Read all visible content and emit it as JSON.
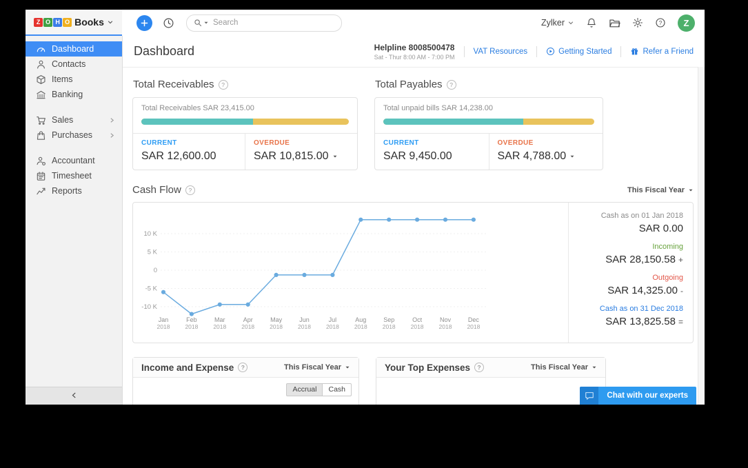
{
  "topbar": {
    "logo_tiles": [
      {
        "letter": "Z",
        "color": "#e5342f"
      },
      {
        "letter": "O",
        "color": "#41a044"
      },
      {
        "letter": "H",
        "color": "#3a7ce8"
      },
      {
        "letter": "O",
        "color": "#f0b01f"
      }
    ],
    "brand": "Books",
    "search_placeholder": "Search",
    "org_name": "Zylker",
    "avatar_letter": "Z"
  },
  "sidebar": {
    "items": [
      {
        "label": "Dashboard",
        "icon": "gauge",
        "active": true
      },
      {
        "label": "Contacts",
        "icon": "contacts"
      },
      {
        "label": "Items",
        "icon": "items"
      },
      {
        "label": "Banking",
        "icon": "banking"
      },
      {
        "label": "Sales",
        "icon": "sales",
        "expandable": true,
        "gap_before": true
      },
      {
        "label": "Purchases",
        "icon": "purchases",
        "expandable": true
      },
      {
        "label": "Accountant",
        "icon": "accountant",
        "gap_before": true
      },
      {
        "label": "Timesheet",
        "icon": "timesheet"
      },
      {
        "label": "Reports",
        "icon": "reports"
      }
    ]
  },
  "header": {
    "title": "Dashboard",
    "helpline": "Helpline 8008500478",
    "helpline_hours": "Sat - Thur 8:00 AM - 7:00 PM",
    "vat_link": "VAT Resources",
    "getting_started": "Getting Started",
    "refer": "Refer a Friend"
  },
  "receivables": {
    "title": "Total Receivables",
    "summary": "Total Receivables SAR 23,415.00",
    "progress_pct": 53.8,
    "current_label": "CURRENT",
    "current_value": "SAR 12,600.00",
    "overdue_label": "OVERDUE",
    "overdue_value": "SAR 10,815.00"
  },
  "payables": {
    "title": "Total Payables",
    "summary": "Total unpaid bills SAR 14,238.00",
    "progress_pct": 66.4,
    "current_label": "CURRENT",
    "current_value": "SAR 9,450.00",
    "overdue_label": "OVERDUE",
    "overdue_value": "SAR 4,788.00"
  },
  "cashflow": {
    "title": "Cash Flow",
    "period": "This Fiscal Year",
    "stats": [
      {
        "label": "Cash as on 01 Jan 2018",
        "value": "SAR 0.00",
        "op": "",
        "tone": "muted"
      },
      {
        "label": "Incoming",
        "value": "SAR 28,150.58",
        "op": "+",
        "tone": "green"
      },
      {
        "label": "Outgoing",
        "value": "SAR 14,325.00",
        "op": "-",
        "tone": "red"
      },
      {
        "label": "Cash as on 31 Dec 2018",
        "value": "SAR 13,825.58",
        "op": "=",
        "tone": "blue"
      }
    ]
  },
  "chart_data": {
    "type": "line",
    "title": "Cash Flow",
    "x": [
      "Jan 2018",
      "Feb 2018",
      "Mar 2018",
      "Apr 2018",
      "May 2018",
      "Jun 2018",
      "Jul 2018",
      "Aug 2018",
      "Sep 2018",
      "Oct 2018",
      "Nov 2018",
      "Dec 2018"
    ],
    "values": [
      -6000,
      -12000,
      -9400,
      -9400,
      -1300,
      -1300,
      -1300,
      13825.58,
      13825.58,
      13825.58,
      13825.58,
      13825.58
    ],
    "yticks": [
      {
        "label": "10 K",
        "value": 10000
      },
      {
        "label": "5 K",
        "value": 5000
      },
      {
        "label": "0",
        "value": 0
      },
      {
        "label": "-5 K",
        "value": -5000
      },
      {
        "label": "-10 K",
        "value": -10000
      }
    ],
    "ylim": [
      -13800,
      15600
    ],
    "xlabel": "",
    "ylabel": "",
    "grid": true,
    "legend": "none",
    "line_color": "#6aabdf"
  },
  "income_expense": {
    "title": "Income and Expense",
    "period": "This Fiscal Year",
    "toggles": [
      "Accrual",
      "Cash"
    ],
    "active_toggle": "Accrual"
  },
  "top_expenses": {
    "title": "Your Top Expenses",
    "period": "This Fiscal Year"
  },
  "chat": {
    "label": "Chat with our experts"
  },
  "colors": {
    "teal": "#5cc3bd",
    "yellow": "#e9c35c",
    "current_blue": "#2d9cf4",
    "overdue_orange": "#e8744a",
    "incoming_green": "#67a23c",
    "outgoing_red": "#e3574a",
    "link_blue": "#2a7de1",
    "sidebar_active_blue": "#3f8df5",
    "avatar_green": "#4db06b",
    "chart_line_blue": "#6aabdf"
  }
}
